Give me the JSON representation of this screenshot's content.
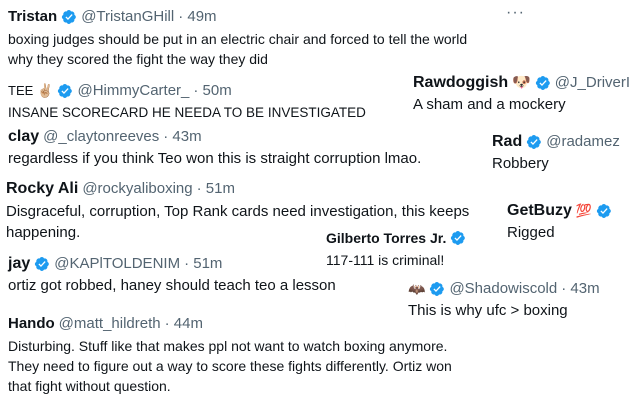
{
  "accent_color": "#1d9bf0",
  "tweets": [
    {
      "name": "Tristan",
      "handle": "@TristanGHill",
      "time": "· 49m",
      "verified": true,
      "lines": [
        "boxing judges should be put in an electric chair and forced to tell the world",
        "why they scored the fight the way they did"
      ]
    },
    {
      "name": "TEE",
      "emoji": "✌🏼",
      "handle": "@HimmyCarter_",
      "time": "· 50m",
      "verified": true,
      "lines": [
        "INSANE SCORECARD HE NEEDA TO BE INVESTIGATED"
      ]
    },
    {
      "name": "Rawdoggish",
      "emoji": "🐶",
      "handle": "@J_DriverI",
      "verified": true,
      "lines": [
        "A sham and a mockery"
      ]
    },
    {
      "name": "clay",
      "handle": "@_claytonreeves",
      "time": "· 43m",
      "lines": [
        "regardless if you think Teo won this is straight corruption lmao."
      ]
    },
    {
      "name": "Rad",
      "handle": "@radamez",
      "verified": true,
      "lines": [
        "Robbery"
      ]
    },
    {
      "name": "Rocky Ali",
      "handle": "@rockyaliboxing",
      "time": "· 51m",
      "lines": [
        "Disgraceful, corruption, Top Rank cards need investigation, this keeps",
        "happening."
      ]
    },
    {
      "name": "GetBuzy",
      "emoji": "💯",
      "verified": true,
      "lines": [
        "Rigged"
      ]
    },
    {
      "name": "Gilberto Torres Jr.",
      "verified": true,
      "lines": [
        "117-111 is criminal!"
      ]
    },
    {
      "name": "jay",
      "handle": "@KAPlTOLDENIM",
      "time": "· 51m",
      "verified": true,
      "lines": [
        "ortiz got robbed, haney should teach teo a lesson"
      ]
    },
    {
      "emoji": "🦇",
      "handle": "@Shadowiscold",
      "time": "· 43m",
      "verified": true,
      "lines": [
        "This is why ufc > boxing"
      ]
    },
    {
      "name": "Hando",
      "handle": "@matt_hildreth",
      "time": "· 44m",
      "lines": [
        "Disturbing. Stuff like that makes ppl not want to watch boxing anymore.",
        "They need to figure out a way to score these fights differently. Ortiz won",
        "that fight without question."
      ]
    }
  ],
  "more_label": "···"
}
